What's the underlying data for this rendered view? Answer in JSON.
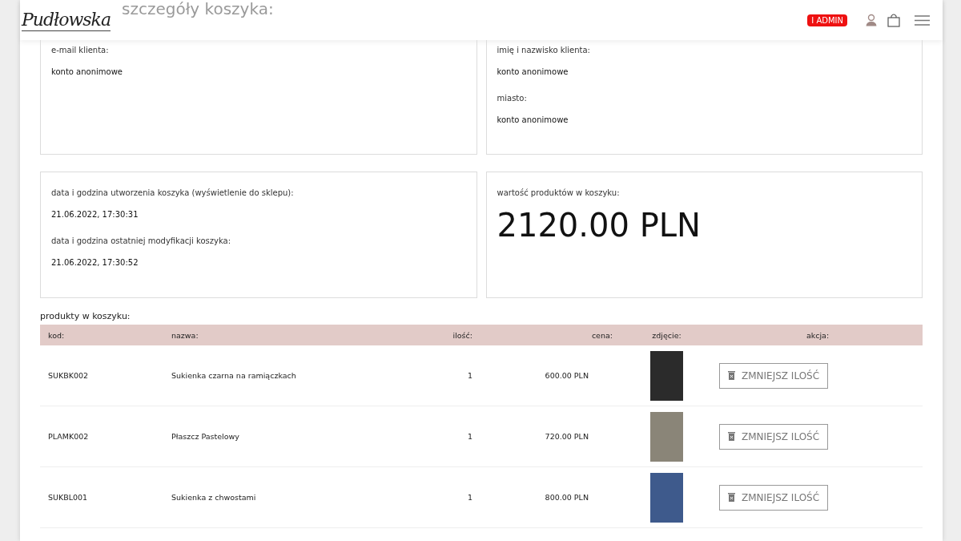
{
  "header": {
    "logo": "Pudłowska",
    "page_title": "szczegóły koszyka:",
    "admin_badge": "I ADMIN"
  },
  "panels": [
    {
      "fields": [
        {
          "label": "e-mail klienta:",
          "value": "konto anonimowe"
        }
      ]
    },
    {
      "fields": [
        {
          "label": "imię i nazwisko klienta:",
          "value": "konto anonimowe"
        },
        {
          "label": "miasto:",
          "value": "konto anonimowe"
        }
      ]
    },
    {
      "fields": [
        {
          "label": "data i godzina utworzenia koszyka (wyświetlenie do sklepu):",
          "value": "21.06.2022, 17:30:31"
        },
        {
          "label": "data i godzina ostatniej modyfikacji koszyka:",
          "value": "21.06.2022, 17:30:52"
        }
      ]
    },
    {
      "fields": [
        {
          "label": "wartość produktów w koszyku:",
          "value": "2120.00 PLN",
          "kind": "big"
        }
      ]
    }
  ],
  "products": {
    "title": "produkty w koszyku:",
    "columns": [
      "kod:",
      "nazwa:",
      "ilość:",
      "cena:",
      "zdjęcie:",
      "akcja:"
    ],
    "rows": [
      {
        "code": "SUKBK002",
        "name": "Sukienka czarna na ramiączkach",
        "qty": "1",
        "price": "600.00 PLN",
        "action": "ZMNIEJSZ ILOŚĆ"
      },
      {
        "code": "PLAMK002",
        "name": "Płaszcz Pastelowy",
        "qty": "1",
        "price": "720.00 PLN",
        "action": "ZMNIEJSZ ILOŚĆ"
      },
      {
        "code": "SUKBL001",
        "name": "Sukienka z chwostami",
        "qty": "1",
        "price": "800.00 PLN",
        "action": "ZMNIEJSZ ILOŚĆ"
      }
    ]
  }
}
